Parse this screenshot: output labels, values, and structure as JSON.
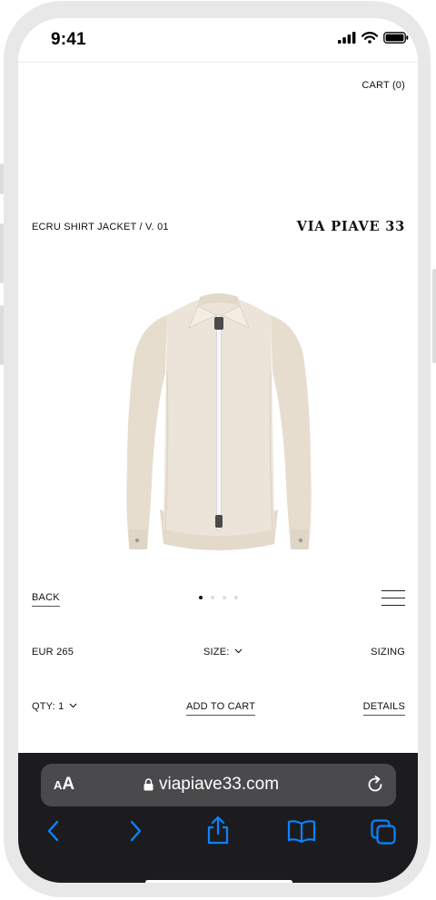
{
  "status": {
    "time": "9:41"
  },
  "header": {
    "cart_label": "CART (0)"
  },
  "product": {
    "title": "ECRU SHIRT JACKET / V. 01",
    "brand": "VIA PIAVE 33",
    "image_alt": "Ecru zip shirt jacket",
    "carousel": {
      "count": 4,
      "active_index": 0
    },
    "price": "EUR 265",
    "size_label": "SIZE:",
    "sizing_label": "SIZING",
    "qty_label": "QTY: 1",
    "add_to_cart_label": "ADD TO CART",
    "details_label": "DETAILS",
    "back_label": "BACK"
  },
  "browser": {
    "text_size_label_small": "A",
    "text_size_label_large": "A",
    "url": "viapiave33.com"
  },
  "colors": {
    "browser_bg": "#1c1c1e",
    "urlbar_bg": "#4a4a4c",
    "accent_blue": "#0a84ff",
    "jacket": "#ece4d8"
  }
}
